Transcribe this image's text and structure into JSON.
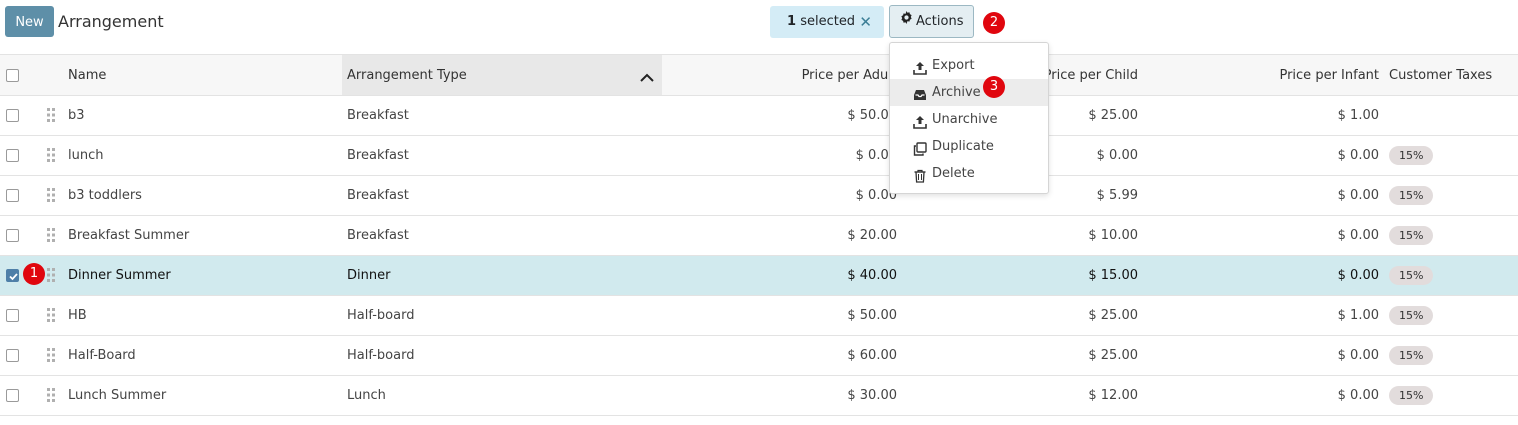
{
  "toolbar": {
    "new_label": "New",
    "title": "Arrangement",
    "selected_count": "1",
    "selected_text": "selected",
    "clear_symbol": "✕",
    "actions_label": "Actions"
  },
  "badges": {
    "checkbox_step": "1",
    "actions_step": "2",
    "archive_step": "3"
  },
  "actions_menu": [
    {
      "label": "Export",
      "icon": "upload-icon"
    },
    {
      "label": "Archive",
      "icon": "inbox-icon"
    },
    {
      "label": "Unarchive",
      "icon": "upload-icon"
    },
    {
      "label": "Duplicate",
      "icon": "copy-icon"
    },
    {
      "label": "Delete",
      "icon": "trash-icon"
    }
  ],
  "table": {
    "columns": [
      "Name",
      "Arrangement Type",
      "Price per Adult",
      "Price per Child",
      "Price per Infant",
      "Customer Taxes"
    ],
    "rows": [
      {
        "name": "b3",
        "type": "Breakfast",
        "adult": "$ 50.00",
        "child": "$ 25.00",
        "infant": "$ 1.00",
        "tax": "",
        "selected": false
      },
      {
        "name": "lunch",
        "type": "Breakfast",
        "adult": "$ 0.00",
        "child": "$ 0.00",
        "infant": "$ 0.00",
        "tax": "15%",
        "selected": false
      },
      {
        "name": "b3 toddlers",
        "type": "Breakfast",
        "adult": "$ 0.00",
        "child": "$ 5.99",
        "infant": "$ 0.00",
        "tax": "15%",
        "selected": false
      },
      {
        "name": "Breakfast Summer",
        "type": "Breakfast",
        "adult": "$ 20.00",
        "child": "$ 10.00",
        "infant": "$ 0.00",
        "tax": "15%",
        "selected": false
      },
      {
        "name": "Dinner Summer",
        "type": "Dinner",
        "adult": "$ 40.00",
        "child": "$ 15.00",
        "infant": "$ 0.00",
        "tax": "15%",
        "selected": true
      },
      {
        "name": "HB",
        "type": "Half-board",
        "adult": "$ 50.00",
        "child": "$ 25.00",
        "infant": "$ 1.00",
        "tax": "15%",
        "selected": false
      },
      {
        "name": "Half-Board",
        "type": "Half-board",
        "adult": "$ 60.00",
        "child": "$ 25.00",
        "infant": "$ 0.00",
        "tax": "15%",
        "selected": false
      },
      {
        "name": "Lunch Summer",
        "type": "Lunch",
        "adult": "$ 30.00",
        "child": "$ 12.00",
        "infant": "$ 0.00",
        "tax": "15%",
        "selected": false
      }
    ]
  },
  "colors": {
    "new_button": "#5e8fa8",
    "selected_pill": "#d4ecf6",
    "selected_row": "#d1eaee",
    "badge": "#e0060e",
    "tax_tag": "#e2dcdc"
  }
}
